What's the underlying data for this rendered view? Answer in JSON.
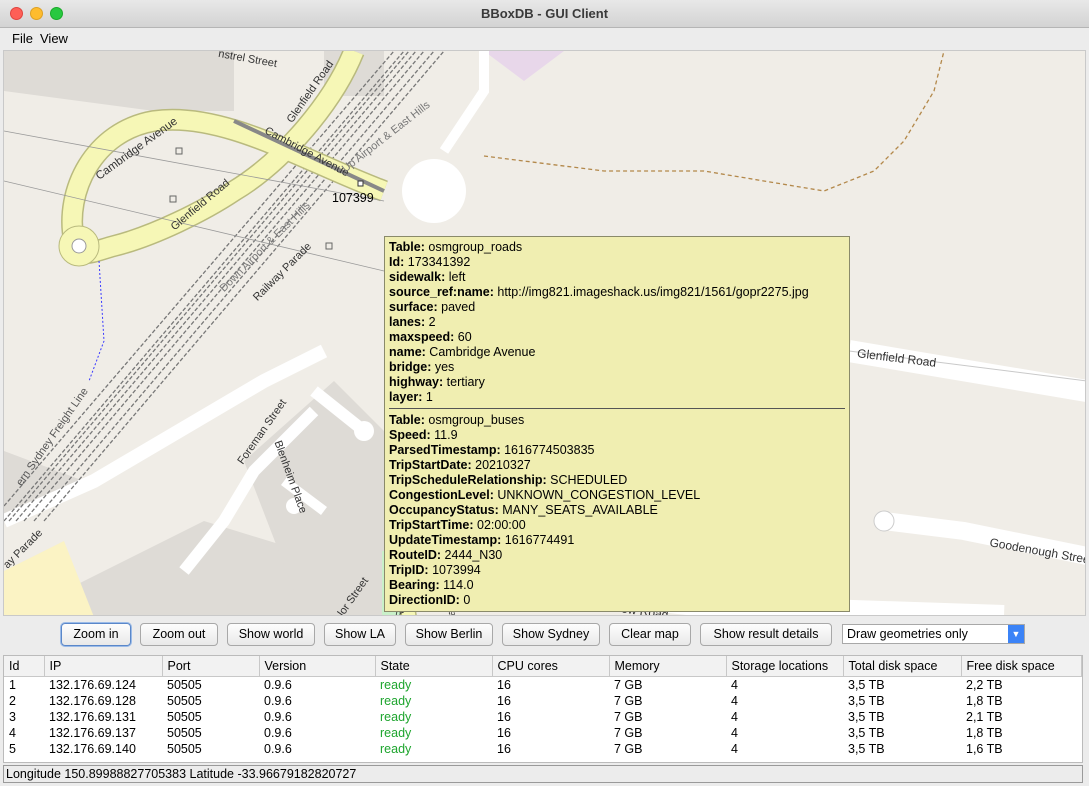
{
  "window": {
    "title": "BBoxDB - GUI Client"
  },
  "menu": {
    "items": [
      "File",
      "View"
    ]
  },
  "map": {
    "labels": {
      "cambridge_avenue": "Cambridge Avenue",
      "cambridge_avenue_2": "Cambridge Avenue",
      "glenfield_road_1": "Glenfield Road",
      "glenfield_road_2": "Glenfield Road",
      "glenfield_road_3": "Glenfield Road",
      "railway_parade": "Railway Parade",
      "railway_parade_2": "ay Parade",
      "up_airport": "Up Airport & East Hills",
      "down_airport": "Down Airport & East Hills",
      "sydney_freight": "ern Sydney Freight Line",
      "foreman_street": "Foreman Street",
      "blenheim_place": "Blenheim Place",
      "harrow_road": "Harrow Road",
      "goodenough_street": "Goodenough Stree",
      "minstrel_street": "nstrel Street",
      "marker_id": "107399",
      "road_label": "Road",
      "lor_street": "lor Street",
      "ace": "ace"
    },
    "popup": {
      "section1": [
        {
          "k": "Table:",
          "v": "osmgroup_roads"
        },
        {
          "k": "Id:",
          "v": "173341392"
        },
        {
          "k": "sidewalk:",
          "v": "left"
        },
        {
          "k": "source_ref:name:",
          "v": "http://img821.imageshack.us/img821/1561/gopr2275.jpg"
        },
        {
          "k": "surface:",
          "v": "paved"
        },
        {
          "k": "lanes:",
          "v": "2"
        },
        {
          "k": "maxspeed:",
          "v": "60"
        },
        {
          "k": "name:",
          "v": "Cambridge Avenue"
        },
        {
          "k": "bridge:",
          "v": "yes"
        },
        {
          "k": "highway:",
          "v": "tertiary"
        },
        {
          "k": "layer:",
          "v": "1"
        }
      ],
      "section2": [
        {
          "k": "Table:",
          "v": "osmgroup_buses"
        },
        {
          "k": "Speed:",
          "v": "11.9"
        },
        {
          "k": "ParsedTimestamp:",
          "v": "1616774503835"
        },
        {
          "k": "TripStartDate:",
          "v": "20210327"
        },
        {
          "k": "TripScheduleRelationship:",
          "v": "SCHEDULED"
        },
        {
          "k": "CongestionLevel:",
          "v": "UNKNOWN_CONGESTION_LEVEL"
        },
        {
          "k": "OccupancyStatus:",
          "v": "MANY_SEATS_AVAILABLE"
        },
        {
          "k": "TripStartTime:",
          "v": "02:00:00"
        },
        {
          "k": "UpdateTimestamp:",
          "v": "1616774491"
        },
        {
          "k": "RouteID:",
          "v": "2444_N30"
        },
        {
          "k": "TripID:",
          "v": "1073994"
        },
        {
          "k": "Bearing:",
          "v": "114.0"
        },
        {
          "k": "DirectionID:",
          "v": "0"
        }
      ]
    }
  },
  "toolbar": {
    "zoom_in": "Zoom in",
    "zoom_out": "Zoom out",
    "show_world": "Show world",
    "show_la": "Show LA",
    "show_berlin": "Show Berlin",
    "show_sydney": "Show Sydney",
    "clear_map": "Clear map",
    "show_result_details": "Show result details",
    "draw_mode": "Draw geometries only"
  },
  "table": {
    "headers": [
      "Id",
      "IP",
      "Port",
      "Version",
      "State",
      "CPU cores",
      "Memory",
      "Storage locations",
      "Total disk space",
      "Free disk space"
    ],
    "rows": [
      [
        "1",
        "132.176.69.124",
        "50505",
        "0.9.6",
        "ready",
        "16",
        "7 GB",
        "4",
        "3,5 TB",
        "2,2 TB"
      ],
      [
        "2",
        "132.176.69.128",
        "50505",
        "0.9.6",
        "ready",
        "16",
        "7 GB",
        "4",
        "3,5 TB",
        "1,8 TB"
      ],
      [
        "3",
        "132.176.69.131",
        "50505",
        "0.9.6",
        "ready",
        "16",
        "7 GB",
        "4",
        "3,5 TB",
        "2,1 TB"
      ],
      [
        "4",
        "132.176.69.137",
        "50505",
        "0.9.6",
        "ready",
        "16",
        "7 GB",
        "4",
        "3,5 TB",
        "1,8 TB"
      ],
      [
        "5",
        "132.176.69.140",
        "50505",
        "0.9.6",
        "ready",
        "16",
        "7 GB",
        "4",
        "3,5 TB",
        "1,6 TB"
      ]
    ]
  },
  "status": {
    "text": "Longitude 150.89988827705383 Latitude -33.96679182820727"
  },
  "colors": {
    "ready": "#1ea52e",
    "popup_bg": "#f0eeb1",
    "road_yellow": "#f6f7b6",
    "map_bg": "#f0ede7"
  }
}
